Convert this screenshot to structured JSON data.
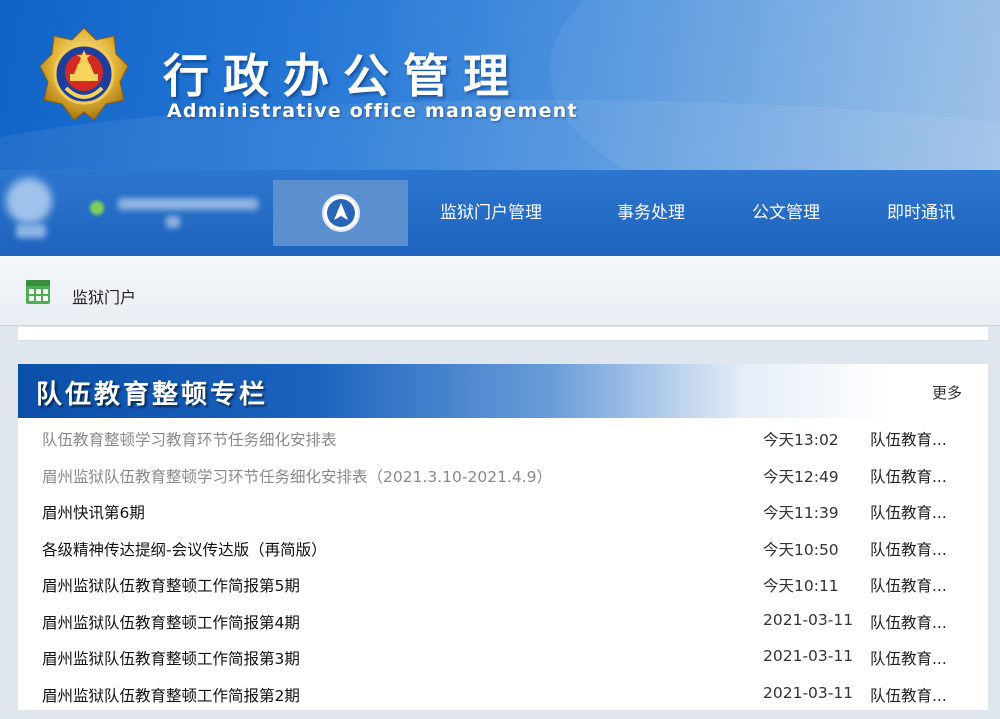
{
  "header": {
    "title_cn": "行政办公管理",
    "title_en": "Administrative office management"
  },
  "nav": {
    "items": [
      {
        "label": "监狱门户管理"
      },
      {
        "label": "事务处理"
      },
      {
        "label": "公文管理"
      },
      {
        "label": "即时通讯"
      }
    ]
  },
  "breadcrumb": {
    "label": "监狱门户"
  },
  "section": {
    "title": "队伍教育整顿专栏",
    "more_label": "更多",
    "rows": [
      {
        "title": "队伍教育整顿学习教育环节任务细化安排表",
        "date": "今天13:02",
        "category": "队伍教育...",
        "read": true
      },
      {
        "title": "眉州监狱队伍教育整顿学习环节任务细化安排表（2021.3.10-2021.4.9）",
        "date": "今天12:49",
        "category": "队伍教育...",
        "read": true
      },
      {
        "title": "眉州快讯第6期",
        "date": "今天11:39",
        "category": "队伍教育...",
        "read": false
      },
      {
        "title": "各级精神传达提纲-会议传达版（再简版）",
        "date": "今天10:50",
        "category": "队伍教育...",
        "read": false
      },
      {
        "title": "眉州监狱队伍教育整顿工作简报第5期",
        "date": "今天10:11",
        "category": "队伍教育...",
        "read": false
      },
      {
        "title": "眉州监狱队伍教育整顿工作简报第4期",
        "date": "2021-03-11",
        "category": "队伍教育...",
        "read": false
      },
      {
        "title": "眉州监狱队伍教育整顿工作简报第3期",
        "date": "2021-03-11",
        "category": "队伍教育...",
        "read": false
      },
      {
        "title": "眉州监狱队伍教育整顿工作简报第2期",
        "date": "2021-03-11",
        "category": "队伍教育...",
        "read": false
      }
    ]
  },
  "icons": {
    "emblem": "police-emblem-icon",
    "home": "home-navigation-icon",
    "breadcrumb": "grid-table-icon"
  },
  "colors": {
    "banner": "#1f6fd0",
    "nav": "#2369c5",
    "online": "#7fd35a",
    "grid_icon": "#4caf50"
  }
}
